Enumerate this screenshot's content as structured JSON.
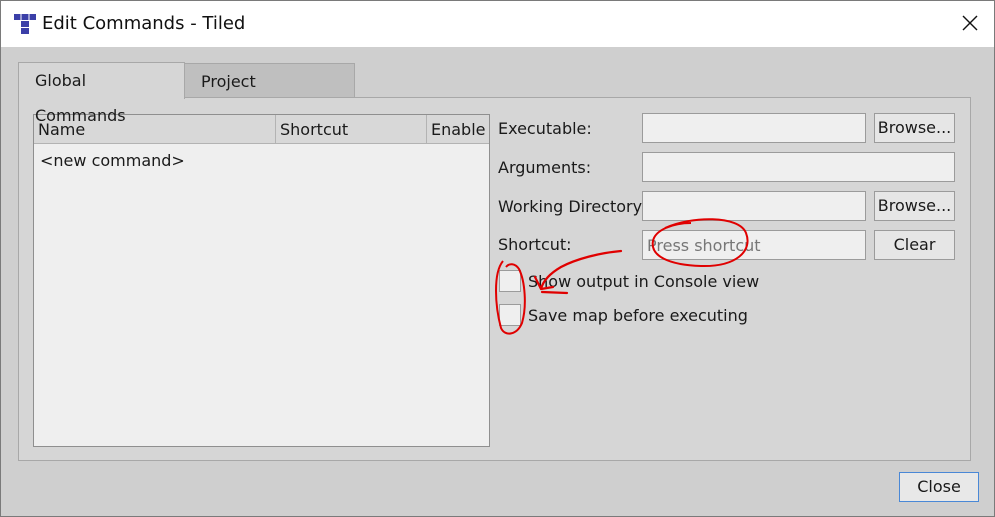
{
  "window": {
    "title": "Edit Commands - Tiled"
  },
  "tabs": [
    {
      "label": "Global Commands",
      "active": true
    },
    {
      "label": "Project Commands",
      "active": false
    }
  ],
  "list": {
    "columns": [
      "Name",
      "Shortcut",
      "Enable"
    ],
    "items": [
      "<new command>"
    ]
  },
  "form": {
    "executable_label": "Executable:",
    "executable_value": "",
    "arguments_label": "Arguments:",
    "arguments_value": "",
    "workdir_label": "Working Directory:",
    "workdir_value": "",
    "shortcut_label": "Shortcut:",
    "shortcut_placeholder": "Press shortcut",
    "browse_label": "Browse...",
    "clear_label": "Clear",
    "show_output_label": "Show output in Console view",
    "show_output_checked": false,
    "save_map_label": "Save map before executing",
    "save_map_checked": false
  },
  "footer": {
    "close_label": "Close"
  },
  "colors": {
    "annotation": "#e00000",
    "tiled_icon": "#3b3fa8",
    "focus_border": "#4a88d6"
  }
}
